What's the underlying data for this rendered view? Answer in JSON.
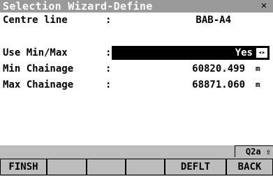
{
  "window": {
    "title": "Selection Wizard-Define",
    "close_glyph": "✕"
  },
  "fields": {
    "centre_line": {
      "label": "Centre line",
      "value": "BAB-A4"
    },
    "use_minmax": {
      "label": "Use Min/Max",
      "value": "Yes",
      "toggle_glyph": "◂▸"
    },
    "min_chainage": {
      "label": "Min Chainage",
      "value": "60820.499",
      "unit": "m"
    },
    "max_chainage": {
      "label": "Max Chainage",
      "value": "68871.060",
      "unit": "m"
    },
    "colon": ":"
  },
  "status": {
    "indicator": "Q2a ⇧"
  },
  "softkeys": [
    {
      "label": "FINSH"
    },
    {
      "label": ""
    },
    {
      "label": ""
    },
    {
      "label": ""
    },
    {
      "label": "DEFLT"
    },
    {
      "label": "BACK"
    }
  ],
  "colors": {
    "title_bg": "#9a9a9a",
    "panel_bg": "#bdbdbd",
    "selection_bg": "#000000"
  }
}
